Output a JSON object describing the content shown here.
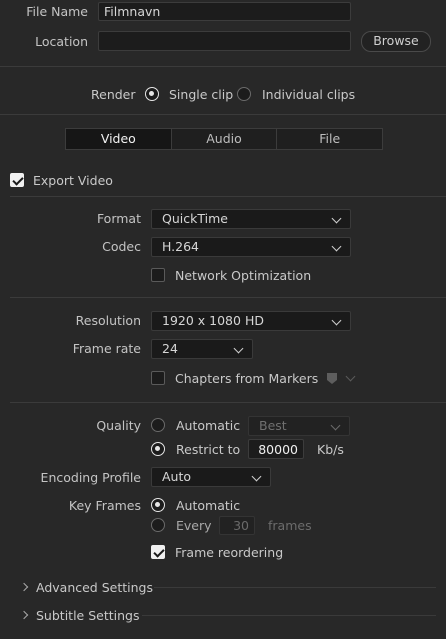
{
  "file": {
    "name_label": "File Name",
    "name_value": "Filmnavn",
    "location_label": "Location",
    "location_value": "",
    "browse_label": "Browse"
  },
  "render": {
    "label": "Render",
    "single_clip": "Single clip",
    "individual_clips": "Individual clips",
    "selected": "Single clip"
  },
  "tabs": [
    {
      "label": "Video",
      "active": true
    },
    {
      "label": "Audio",
      "active": false
    },
    {
      "label": "File",
      "active": false
    }
  ],
  "export_video": {
    "label": "Export Video",
    "checked": true
  },
  "format": {
    "label": "Format",
    "value": "QuickTime"
  },
  "codec": {
    "label": "Codec",
    "value": "H.264"
  },
  "network_optimization": {
    "label": "Network Optimization",
    "checked": false
  },
  "resolution": {
    "label": "Resolution",
    "value": "1920 x 1080 HD"
  },
  "frame_rate": {
    "label": "Frame rate",
    "value": "24"
  },
  "chapters": {
    "label": "Chapters from Markers",
    "checked": false
  },
  "quality": {
    "label": "Quality",
    "automatic": "Automatic",
    "automatic_value": "Best",
    "restrict": "Restrict to",
    "restrict_value": "80000",
    "unit": "Kb/s",
    "selected": "Restrict to"
  },
  "encoding_profile": {
    "label": "Encoding Profile",
    "value": "Auto"
  },
  "key_frames": {
    "label": "Key Frames",
    "automatic": "Automatic",
    "every": "Every",
    "every_value": "30",
    "unit": "frames",
    "selected": "Automatic"
  },
  "frame_reordering": {
    "label": "Frame reordering",
    "checked": true
  },
  "sections": {
    "advanced": "Advanced Settings",
    "subtitle": "Subtitle Settings"
  }
}
